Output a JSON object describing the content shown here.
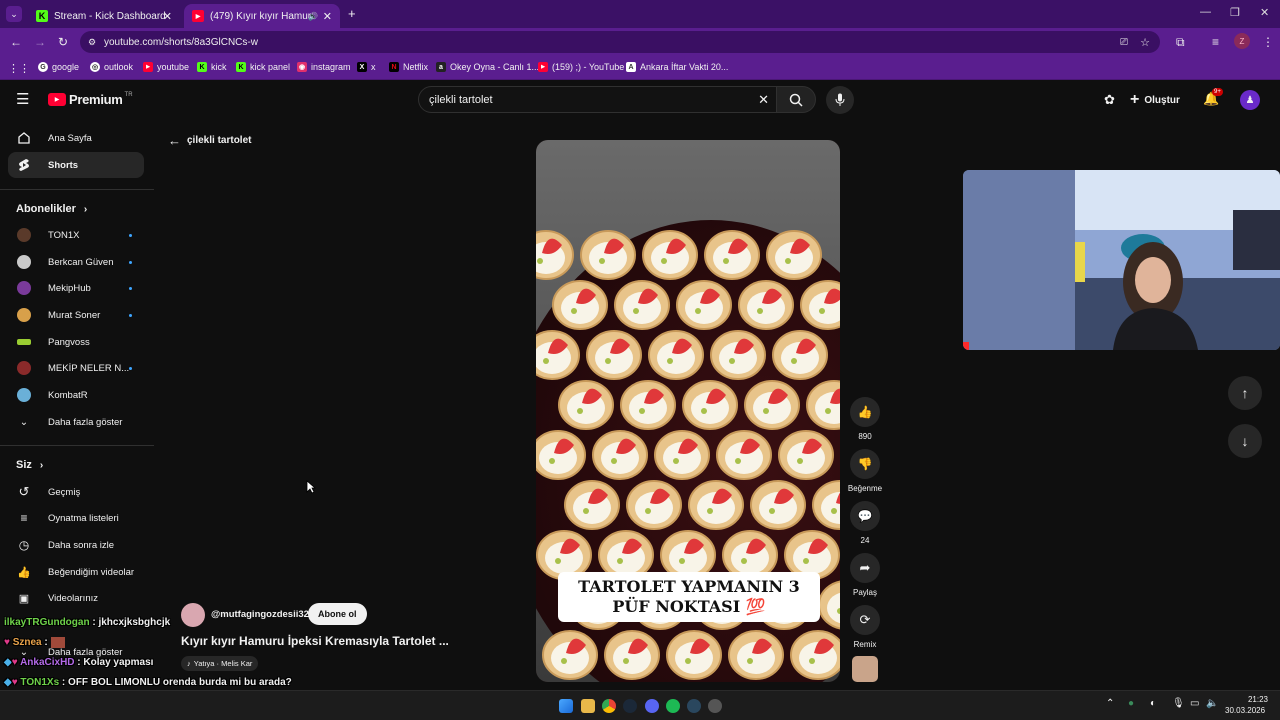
{
  "browser": {
    "tabs": [
      {
        "title": "Stream - Kick Dashboard",
        "icon": "kick-icon",
        "active": false
      },
      {
        "title": "(479) Kıyır kıyır Hamuru İpek",
        "icon": "youtube-icon",
        "active": true
      }
    ],
    "url": "youtube.com/shorts/8a3GlCNCs-w",
    "profile_letter": "Z",
    "bookmarks": [
      {
        "label": "google",
        "icon": "google-icon"
      },
      {
        "label": "outlook",
        "icon": "outlook-icon"
      },
      {
        "label": "youtube",
        "icon": "youtube-icon"
      },
      {
        "label": "kick",
        "icon": "kick-icon"
      },
      {
        "label": "kick panel",
        "icon": "kick-icon"
      },
      {
        "label": "instagram",
        "icon": "instagram-icon"
      },
      {
        "label": "x",
        "icon": "x-icon"
      },
      {
        "label": "Netflix",
        "icon": "netflix-icon"
      },
      {
        "label": "Okey Oyna - Canlı 1...",
        "icon": "okey-icon"
      },
      {
        "label": "(159) ;) - YouTube",
        "icon": "youtube-icon"
      },
      {
        "label": "Ankara İftar Vakti 20...",
        "icon": "calendar-icon"
      }
    ]
  },
  "youtube": {
    "logo": "Premium",
    "logo_sup": "TR",
    "search_value": "çilekli tartolet",
    "create_label": "Oluştur",
    "notif_badge": "9+",
    "back_label": "çilekli tartolet"
  },
  "sidebar": {
    "main": [
      {
        "label": "Ana Sayfa",
        "icon": "home-icon"
      },
      {
        "label": "Shorts",
        "icon": "shorts-icon"
      }
    ],
    "subs_title": "Abonelikler",
    "subs": [
      {
        "label": "TON1X",
        "color": "#5a3a2a",
        "dot": true
      },
      {
        "label": "Berkcan Güven",
        "color": "#c9c9c9",
        "dot": true
      },
      {
        "label": "MekipHub",
        "color": "#7a3a9a",
        "dot": true
      },
      {
        "label": "Murat Soner",
        "color": "#d8a04a",
        "dot": true
      },
      {
        "label": "Pangvoss",
        "color": "#9acd32",
        "dot": false
      },
      {
        "label": "MEKİP NELER N...",
        "color": "#8a2a2a",
        "dot": true
      },
      {
        "label": "KombatR",
        "color": "#6ab0d8",
        "dot": false
      }
    ],
    "more_label": "Daha fazla göster",
    "you_title": "Siz",
    "you": [
      {
        "label": "Geçmiş",
        "icon": "history-icon"
      },
      {
        "label": "Oynatma listeleri",
        "icon": "playlist-icon"
      },
      {
        "label": "Daha sonra izle",
        "icon": "clock-icon"
      },
      {
        "label": "Beğendiğim videolar",
        "icon": "like-icon"
      },
      {
        "label": "Videolarınız",
        "icon": "video-icon"
      }
    ],
    "you_more": "Daha fazla göster"
  },
  "short": {
    "overlay_line1": "TARTOLET YAPMANIN 3",
    "overlay_line2": "PÜF NOKTASI 💯",
    "channel": "@mutfagingozdesii32",
    "subscribe": "Abone ol",
    "title": "Kıyır kıyır Hamuru İpeksi Kremasıyla Tartolet ...",
    "music": "Yatıya · Melis Kar",
    "likes": "890",
    "dislike_label": "Beğenme",
    "comments": "24",
    "share_label": "Paylaş",
    "remix_label": "Remix"
  },
  "chat": [
    {
      "user": "ilkayTRGundogan",
      "sep": " : ",
      "msg": "jkhcxjksbghcjk",
      "color": "#6fd34a"
    },
    {
      "user": "Sznea",
      "sep": " : ",
      "msg": "",
      "color": "#e8a24a"
    },
    {
      "user": "AnkaCixHD",
      "sep": " : ",
      "msg": "Kolay yapması",
      "color": "#b46ae8"
    },
    {
      "user": "TON1Xs",
      "sep": " : ",
      "msg": "OFF BOL LIMONLU orenda burda mi bu arada?",
      "color": "#6fd34a"
    }
  ],
  "taskbar": {
    "time": "21:23",
    "date": "30.03.2026"
  },
  "colors": {
    "browser_tab": "#3b1166",
    "browser_toolbar": "#5a1e8f",
    "yt_bg": "#0f0f0f",
    "yt_red": "#ff0033"
  }
}
